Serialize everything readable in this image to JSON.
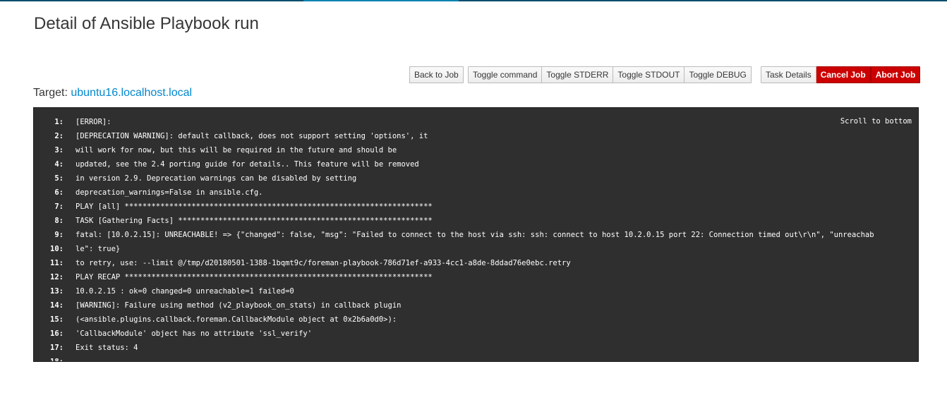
{
  "page": {
    "title": "Detail of Ansible Playbook run"
  },
  "toolbar": {
    "back_to_job": "Back to Job",
    "toggle_command": "Toggle command",
    "toggle_stderr": "Toggle STDERR",
    "toggle_stdout": "Toggle STDOUT",
    "toggle_debug": "Toggle DEBUG",
    "task_details": "Task Details",
    "cancel_job": "Cancel Job",
    "abort_job": "Abort Job"
  },
  "target": {
    "label": "Target:",
    "host": "ubuntu16.localhost.local"
  },
  "console": {
    "scroll_to_bottom": "Scroll to bottom",
    "lines": [
      {
        "num": "1:",
        "text": "[ERROR]:"
      },
      {
        "num": "2:",
        "text": "[DEPRECATION WARNING]: default callback, does not support setting 'options', it"
      },
      {
        "num": "3:",
        "text": "will work for now, but this will be required in the future and should be"
      },
      {
        "num": "4:",
        "text": "updated, see the 2.4 porting guide for details.. This feature will be removed"
      },
      {
        "num": "5:",
        "text": "in version 2.9. Deprecation warnings can be disabled by setting"
      },
      {
        "num": "6:",
        "text": "deprecation_warnings=False in ansible.cfg."
      },
      {
        "num": "7:",
        "text": "PLAY [all] *********************************************************************"
      },
      {
        "num": "8:",
        "text": "TASK [Gathering Facts] *********************************************************"
      },
      {
        "num": "9:",
        "text": "fatal: [10.0.2.15]: UNREACHABLE! => {\"changed\": false, \"msg\": \"Failed to connect to the host via ssh: ssh: connect to host 10.2.0.15 port 22: Connection timed out\\r\\n\", \"unreachab"
      },
      {
        "num": "10:",
        "text": "le\": true}"
      },
      {
        "num": "11:",
        "text": "to retry, use: --limit @/tmp/d20180501-1388-1bqmt9c/foreman-playbook-786d71ef-a933-4cc1-a8de-8ddad76e0ebc.retry"
      },
      {
        "num": "12:",
        "text": "PLAY RECAP *********************************************************************"
      },
      {
        "num": "13:",
        "text": "10.0.2.15 : ok=0 changed=0 unreachable=1 failed=0"
      },
      {
        "num": "14:",
        "text": "[WARNING]: Failure using method (v2_playbook_on_stats) in callback plugin"
      },
      {
        "num": "15:",
        "text": "(<ansible.plugins.callback.foreman.CallbackModule object at 0x2b6a0d0>):"
      },
      {
        "num": "16:",
        "text": "'CallbackModule' object has no attribute 'ssl_verify'"
      },
      {
        "num": "17:",
        "text": "Exit status: 4"
      },
      {
        "num": "18:",
        "text": ""
      }
    ]
  },
  "colors": {
    "console_bg": "#2f2f2f",
    "danger": "#cc0000",
    "link": "#0088ce"
  }
}
